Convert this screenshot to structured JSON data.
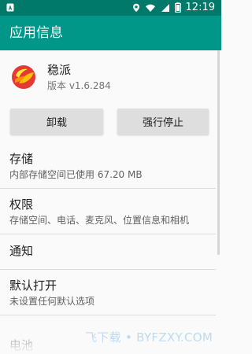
{
  "status_bar": {
    "left_icon": "a-notification-icon",
    "icons": [
      "location-icon",
      "wifi-icon",
      "signal-icon",
      "battery-icon"
    ],
    "time": "12:19"
  },
  "appbar": {
    "title": "应用信息"
  },
  "app": {
    "name": "稳派",
    "version": "版本 v1.6.284",
    "icon": "app-logo-icon"
  },
  "actions": {
    "uninstall": "卸载",
    "force_stop": "强行停止"
  },
  "list": [
    {
      "title": "存储",
      "subtitle": "内部存储空间已使用 67.20 MB"
    },
    {
      "title": "权限",
      "subtitle": "存储空间、电话、麦克风、位置信息和相机"
    },
    {
      "title": "通知"
    },
    {
      "title": "默认打开",
      "subtitle": "未设置任何默认选项"
    }
  ],
  "faded": {
    "title": "电池"
  },
  "watermark": {
    "text": "飞下载 • BYFZXY.COM"
  },
  "colors": {
    "status_bar": "#00796b",
    "appbar": "#009688",
    "background": "#fafafa",
    "button": "#dedede",
    "text_primary": "#212121",
    "text_secondary": "#616161",
    "divider": "#dedede"
  }
}
